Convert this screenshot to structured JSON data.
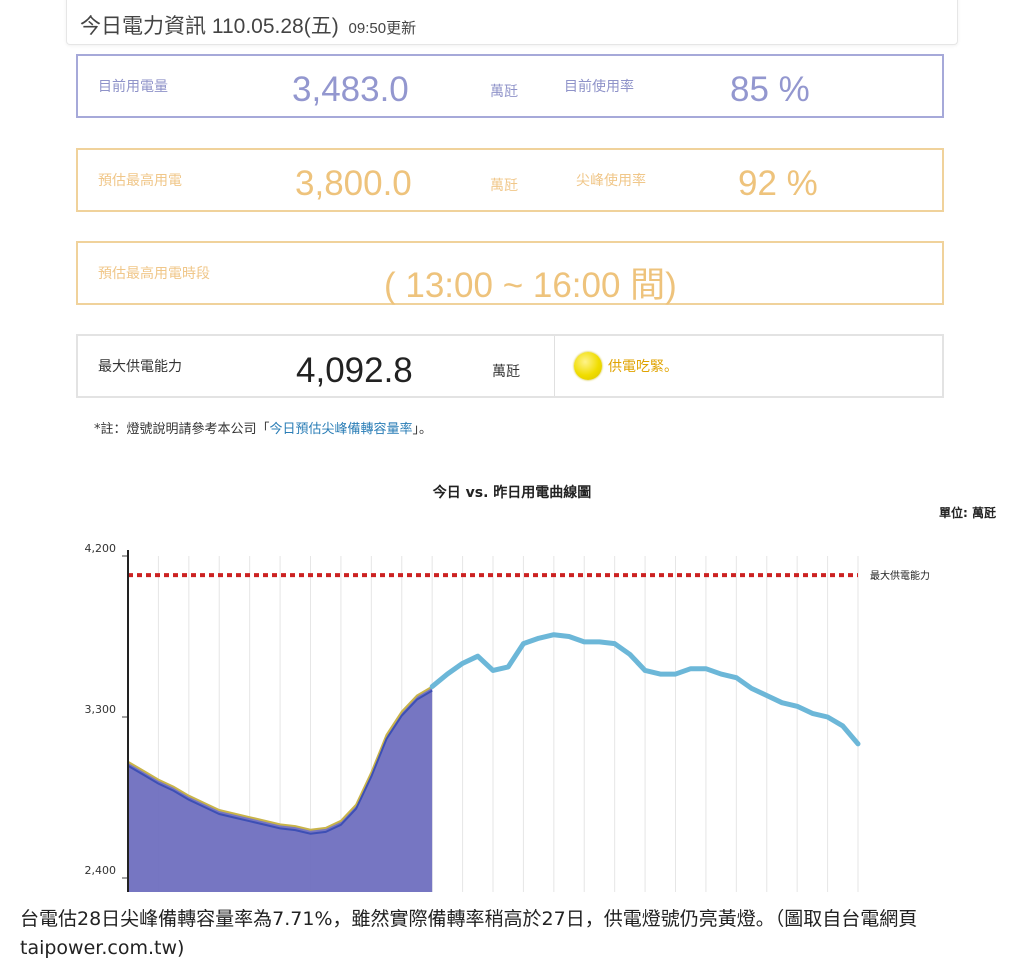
{
  "header": {
    "title": "今日電力資訊 110.05.28(五)",
    "update": "09:50更新"
  },
  "current": {
    "load_label": "目前用電量",
    "load_value": "3,483.0",
    "load_unit": "萬瓩",
    "rate_label": "目前使用率",
    "rate_value": "85 %"
  },
  "forecast": {
    "peak_label": "預估最高用電",
    "peak_value": "3,800.0",
    "peak_unit": "萬瓩",
    "peak_rate_label": "尖峰使用率",
    "peak_rate_value": "92 %"
  },
  "period": {
    "label": "預估最高用電時段",
    "value": "( 13:00 ~ 16:00  間)"
  },
  "supply": {
    "label": "最大供電能力",
    "value": "4,092.8",
    "unit": "萬瓩",
    "status": "供電吃緊。",
    "lamp_color": "#f0dd00"
  },
  "note": {
    "prefix": "*註：燈號說明請參考本公司「",
    "link": "今日預估尖峰備轉容量率",
    "suffix": "」。"
  },
  "chart_data": {
    "type": "line",
    "title": "今日 vs. 昨日用電曲線圖",
    "unit": "單位: 萬瓩",
    "ylim": [
      2400,
      4200
    ],
    "yticks": [
      2400,
      3300,
      4200
    ],
    "ytick_labels": [
      "2,400",
      "3,300",
      "4,200"
    ],
    "capacity_line": {
      "label": "最大供電能力",
      "value": 4092.8,
      "color": "#cc2222"
    },
    "series": [
      {
        "kind": "today-area",
        "color": "#6f6fbf",
        "x": [
          0,
          0.5,
          1,
          1.5,
          2,
          2.5,
          3,
          3.5,
          4,
          4.5,
          5,
          5.5,
          6,
          6.5,
          7,
          7.5,
          8,
          8.5,
          9,
          9.5,
          10
        ],
        "values": [
          3050,
          3000,
          2950,
          2910,
          2860,
          2820,
          2780,
          2760,
          2740,
          2720,
          2700,
          2690,
          2670,
          2680,
          2720,
          2810,
          2990,
          3200,
          3330,
          3420,
          3470
        ]
      },
      {
        "kind": "yesterday-line",
        "color": "#6cb7d8",
        "x": [
          10,
          10.5,
          11,
          11.5,
          12,
          12.5,
          13,
          13.5,
          14,
          14.5,
          15,
          15.5,
          16,
          16.5,
          17,
          17.5,
          18,
          18.5,
          19,
          19.5,
          20,
          20.5,
          21,
          21.5,
          22,
          22.5,
          23,
          23.5,
          24
        ],
        "values": [
          3470,
          3540,
          3600,
          3640,
          3560,
          3580,
          3710,
          3740,
          3760,
          3750,
          3720,
          3720,
          3710,
          3650,
          3560,
          3540,
          3540,
          3570,
          3570,
          3540,
          3520,
          3460,
          3420,
          3380,
          3360,
          3320,
          3300,
          3250,
          3150
        ]
      }
    ]
  },
  "caption": "台電估28日尖峰備轉容量率為7.71%，雖然實際備轉率稍高於27日，供電燈號仍亮黃燈。（圖取自台電網頁 taipower.com.tw)"
}
